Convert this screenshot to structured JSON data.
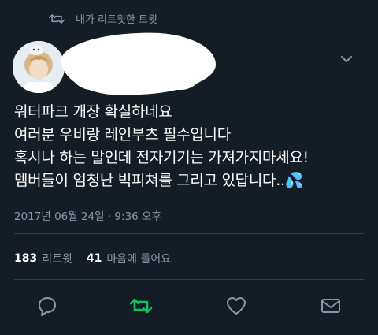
{
  "retweet_header": {
    "label": "내가 리트윗한 트윗",
    "icon": "retweet-icon"
  },
  "author": {
    "avatar_icon": "avatar",
    "name_redacted": true
  },
  "tweet": {
    "lines": [
      "워터파크 개장 확실하네요",
      "여러분 우비랑 레인부츠 필수입니다",
      "혹시나 하는 말인데 전자기기는 가져가지마세요!",
      "멤버들이 엄청난 빅피쳐를 그리고 있답니다..💦"
    ],
    "timestamp": "2017년 06월 24일 · 9:36 오후"
  },
  "stats": {
    "retweet_count": "183",
    "retweet_label": "리트윗",
    "like_count": "41",
    "like_label": "마음에 들어요"
  },
  "actions": {
    "reply_icon": "reply-icon",
    "retweet_icon": "retweet-icon",
    "like_icon": "heart-icon",
    "message_icon": "mail-icon"
  },
  "colors": {
    "background": "#141d26",
    "secondary_text": "#8899a6",
    "retweet_active": "#17bf63",
    "divider": "#2f3f4f"
  }
}
